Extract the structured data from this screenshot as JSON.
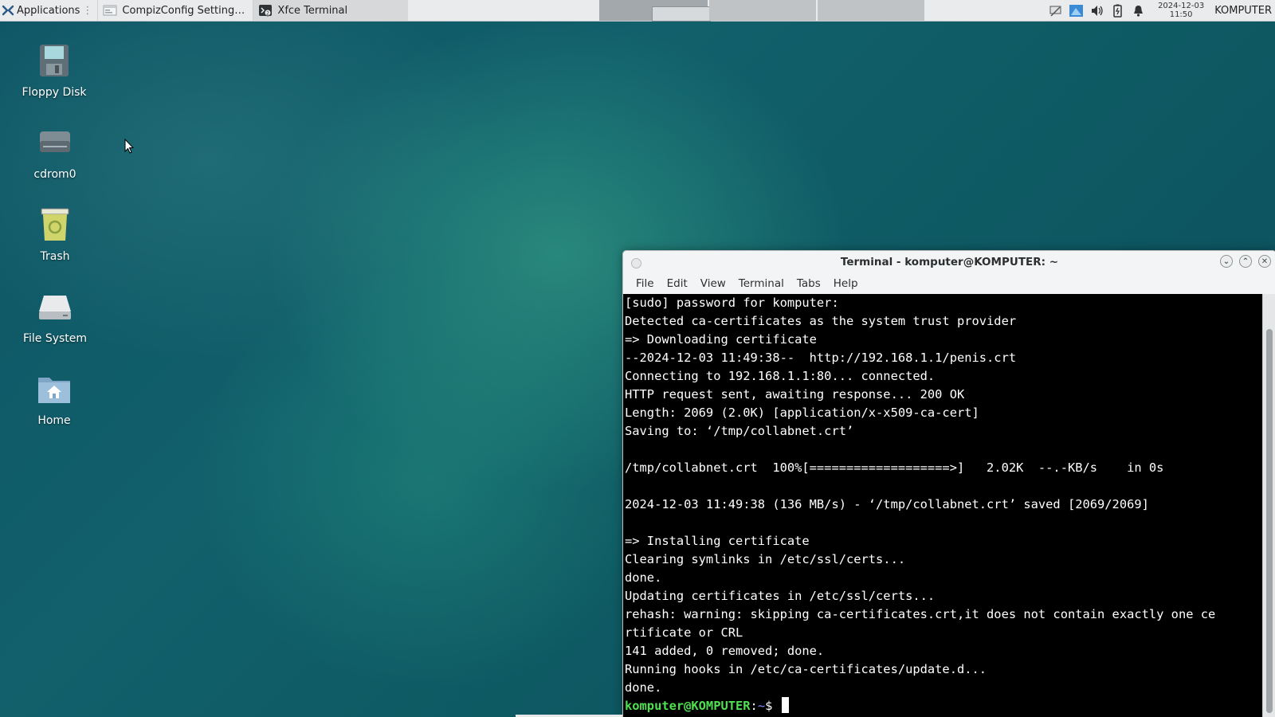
{
  "panel": {
    "applications_label": "Applications",
    "tasks": [
      {
        "label": "CompizConfig Settings ...",
        "active": false
      },
      {
        "label": "Xfce Terminal",
        "active": true
      }
    ],
    "clock_date": "2024-12-03",
    "clock_time": "11:50",
    "hostname": "KOMPUTER",
    "tray_icons": [
      "network-icon",
      "display-icon",
      "volume-icon",
      "battery-icon",
      "notification-bell-icon"
    ]
  },
  "desktop": {
    "icons": [
      {
        "label": "Floppy Disk",
        "icon": "floppy-icon"
      },
      {
        "label": "cdrom0",
        "icon": "cdrom-icon"
      },
      {
        "label": "Trash",
        "icon": "trash-icon"
      },
      {
        "label": "File System",
        "icon": "filesystem-icon"
      },
      {
        "label": "Home",
        "icon": "home-folder-icon"
      }
    ]
  },
  "terminal": {
    "title": "Terminal - komputer@KOMPUTER: ~",
    "menu": [
      "File",
      "Edit",
      "View",
      "Terminal",
      "Tabs",
      "Help"
    ],
    "lines": [
      "[sudo] password for komputer:",
      "Detected ca-certificates as the system trust provider",
      "=> Downloading certificate",
      "--2024-12-03 11:49:38--  http://192.168.1.1/penis.crt",
      "Connecting to 192.168.1.1:80... connected.",
      "HTTP request sent, awaiting response... 200 OK",
      "Length: 2069 (2.0K) [application/x-x509-ca-cert]",
      "Saving to: ‘/tmp/collabnet.crt’",
      "",
      "/tmp/collabnet.crt  100%[===================>]   2.02K  --.-KB/s    in 0s",
      "",
      "2024-12-03 11:49:38 (136 MB/s) - ‘/tmp/collabnet.crt’ saved [2069/2069]",
      "",
      "=> Installing certificate",
      "Clearing symlinks in /etc/ssl/certs...",
      "done.",
      "Updating certificates in /etc/ssl/certs...",
      "rehash: warning: skipping ca-certificates.crt,it does not contain exactly one ce",
      "rtificate or CRL",
      "141 added, 0 removed; done.",
      "Running hooks in /etc/ca-certificates/update.d...",
      "done."
    ],
    "prompt_user": "komputer@KOMPUTER",
    "prompt_sep": ":",
    "prompt_dir": "~",
    "prompt_symbol": "$ "
  },
  "colors": {
    "prompt_user": "#4fe04f",
    "terminal_bg": "#000000",
    "terminal_fg": "#ffffff",
    "panel_bg": "#e9ebed"
  }
}
